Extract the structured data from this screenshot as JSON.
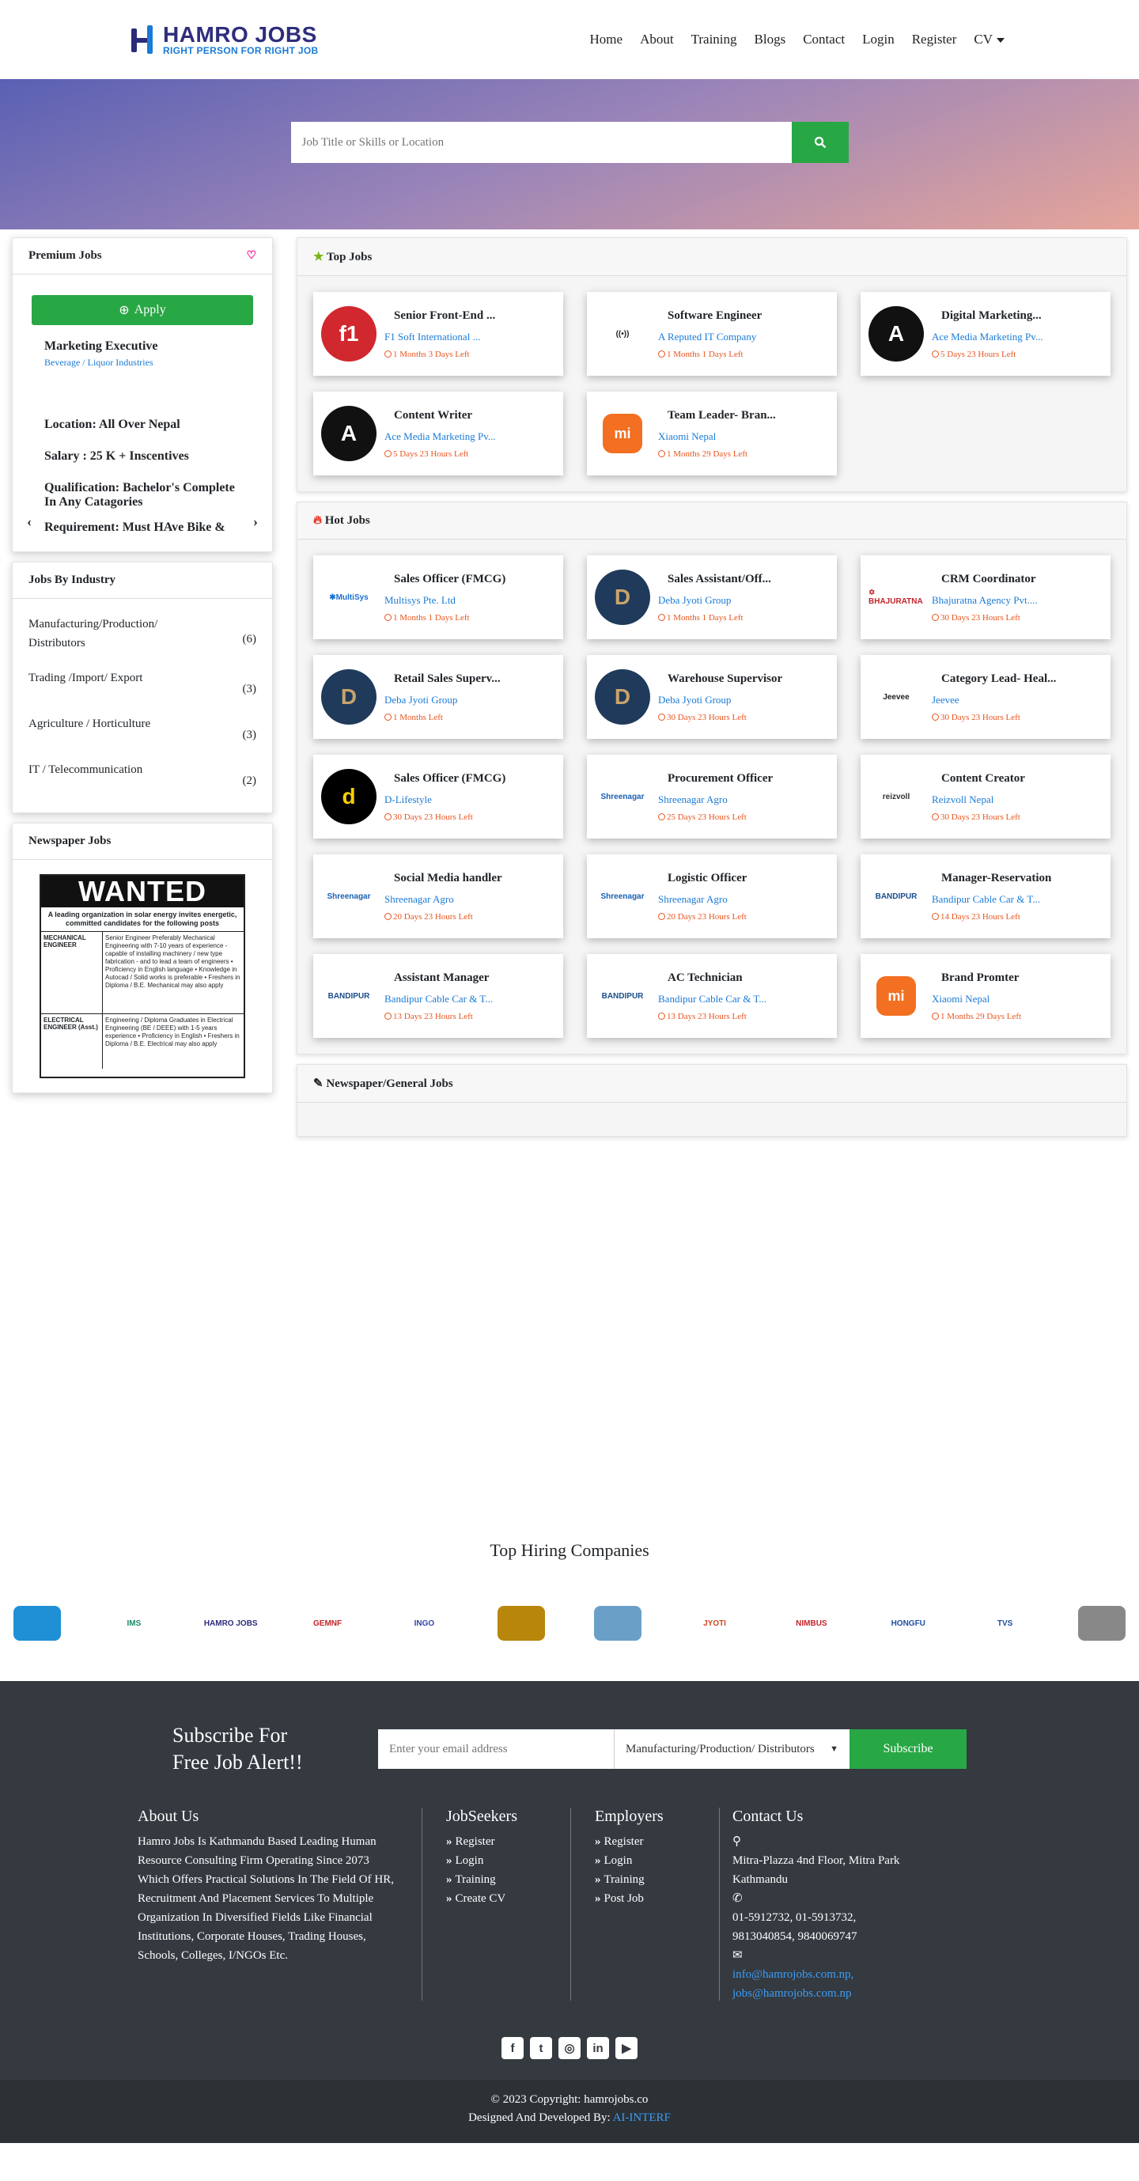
{
  "header": {
    "logo_title": "HAMRO JOBS",
    "logo_tagline": "RIGHT PERSON FOR RIGHT JOB",
    "nav": [
      "Home",
      "About",
      "Training",
      "Blogs",
      "Contact",
      "Login",
      "Register",
      "CV"
    ]
  },
  "search": {
    "placeholder": "Job Title or Skills or Location"
  },
  "premium": {
    "title": "Premium Jobs",
    "apply": "Apply",
    "job_title": "Marketing Executive",
    "company": "Beverage / Liquor Industries",
    "lines": [
      "Location: All Over Nepal",
      "Salary : 25 K + Inscentives",
      "Qualification: Bachelor's Complete In Any Catagories",
      "Requirement: Must HAve Bike &"
    ]
  },
  "industry": {
    "title": "Jobs By Industry",
    "items": [
      {
        "name": "Manufacturing/Production/ Distributors",
        "count": "(6)"
      },
      {
        "name": "Trading /Import/ Export",
        "count": "(3)"
      },
      {
        "name": "Agriculture / Horticulture",
        "count": "(3)"
      },
      {
        "name": "IT / Telecommunication",
        "count": "(2)"
      }
    ]
  },
  "newspaper": {
    "title": "Newspaper Jobs",
    "ad_heading": "WANTED",
    "ad_sub": "A leading organization in solar energy invites energetic, committed candidates for the following posts",
    "ad_rows": [
      {
        "role": "MECHANICAL ENGINEER",
        "detail": "Senior Engineer Preferably Mechanical Engineering with 7-10 years of experience - capable of installing machinery / new type fabrication - and to lead a team of engineers • Proficiency in English language • Knowledge in Autocad / Solid works is preferable • Freshers in Diploma / B.E. Mechanical may also apply"
      },
      {
        "role": "ELECTRICAL ENGINEER (Asst.)",
        "detail": "Engineering / Diploma Graduates in Electrical Engineering (BE / DEEE) with 1-5 years experience • Proficiency in English • Freshers in Diploma / B.E. Electrical may also apply"
      }
    ]
  },
  "top_jobs": {
    "title": "Top Jobs",
    "jobs": [
      {
        "title": "Senior Front-End ...",
        "company": "F1 Soft International ...",
        "deadline": "1 Months 3 Days Left",
        "logo": "f1soft"
      },
      {
        "title": "Software Engineer",
        "company": "A Reputed IT Company",
        "deadline": "1 Months 1 Days Left",
        "logo": "wifi"
      },
      {
        "title": "Digital Marketing...",
        "company": "Ace Media Marketing Pv...",
        "deadline": "5 Days 23 Hours Left",
        "logo": "ace"
      },
      {
        "title": "Content Writer",
        "company": "Ace Media Marketing Pv...",
        "deadline": "5 Days 23 Hours Left",
        "logo": "ace"
      },
      {
        "title": "Team Leader- Bran...",
        "company": "Xiaomi Nepal",
        "deadline": "1 Months 29 Days Left",
        "logo": "mi"
      }
    ]
  },
  "hot_jobs": {
    "title": "Hot Jobs",
    "jobs": [
      {
        "title": "Sales Officer (FMCG)",
        "company": "Multisys Pte. Ltd",
        "deadline": "1 Months 1 Days Left",
        "logo": "multisys"
      },
      {
        "title": "Sales Assistant/Off...",
        "company": "Deba Jyoti Group",
        "deadline": "1 Months 1 Days Left",
        "logo": "deba"
      },
      {
        "title": "CRM Coordinator",
        "company": "Bhajuratna Agency Pvt....",
        "deadline": "30 Days 23 Hours Left",
        "logo": "bhajuratna"
      },
      {
        "title": "Retail Sales Superv...",
        "company": "Deba Jyoti Group",
        "deadline": "1 Months Left",
        "logo": "deba"
      },
      {
        "title": "Warehouse Supervisor",
        "company": "Deba Jyoti Group",
        "deadline": "30 Days 23 Hours Left",
        "logo": "deba"
      },
      {
        "title": "Category Lead- Heal...",
        "company": "Jeevee",
        "deadline": "30 Days 23 Hours Left",
        "logo": "jeevee"
      },
      {
        "title": "Sales Officer (FMCG)",
        "company": "D-Lifestyle",
        "deadline": "30 Days 23 Hours Left",
        "logo": "dlife"
      },
      {
        "title": "Procurement Officer",
        "company": "Shreenagar Agro",
        "deadline": "25 Days 23 Hours Left",
        "logo": "shreenagar"
      },
      {
        "title": "Content Creator",
        "company": "Reizvoll Nepal",
        "deadline": "30 Days 23 Hours Left",
        "logo": "reizvoll"
      },
      {
        "title": "Social Media handler",
        "company": "Shreenagar Agro",
        "deadline": "20 Days 23 Hours Left",
        "logo": "shreenagar"
      },
      {
        "title": "Logistic Officer",
        "company": "Shreenagar Agro",
        "deadline": "20 Days 23 Hours Left",
        "logo": "shreenagar"
      },
      {
        "title": "Manager-Reservation",
        "company": "Bandipur Cable Car & T...",
        "deadline": "14 Days 23 Hours Left",
        "logo": "bandipur"
      },
      {
        "title": "Assistant Manager",
        "company": "Bandipur Cable Car & T...",
        "deadline": "13 Days 23 Hours Left",
        "logo": "bandipur"
      },
      {
        "title": "AC Technician",
        "company": "Bandipur Cable Car & T...",
        "deadline": "13 Days 23 Hours Left",
        "logo": "bandipur"
      },
      {
        "title": "Brand Promter",
        "company": "Xiaomi Nepal",
        "deadline": "1 Months 29 Days Left",
        "logo": "mi"
      }
    ]
  },
  "general_jobs": {
    "title": "Newspaper/General Jobs"
  },
  "companies": {
    "title": "Top Hiring Companies",
    "logos": [
      "snowflake-logo",
      "IMS",
      "HAMRO JOBS",
      "GEMNF",
      "INGO",
      "lion-logo",
      "box-logo",
      "JYOTI",
      "NIMBUS",
      "HONGFU",
      "TVS",
      "bird-logo"
    ]
  },
  "subscribe": {
    "heading": "Subscribe For Free Job Alert!!",
    "email_placeholder": "Enter your email address",
    "select_value": "Manufacturing/Production/ Distributors",
    "button": "Subscribe"
  },
  "footer": {
    "about_title": "About Us",
    "about_text": "Hamro Jobs Is Kathmandu Based Leading Human Resource Consulting Firm Operating Since 2073 Which Offers Practical Solutions In The Field Of HR, Recruitment And Placement Services To Multiple Organization In Diversified Fields Like Financial Institutions, Corporate Houses, Trading Houses, Schools, Colleges, I/NGOs Etc.",
    "seekers_title": "JobSeekers",
    "seekers_links": [
      "Register",
      "Login",
      "Training",
      "Create CV"
    ],
    "employers_title": "Employers",
    "employers_links": [
      "Register",
      "Login",
      "Training",
      "Post Job"
    ],
    "contact_title": "Contact Us",
    "address": "Mitra-Plazza 4nd Floor, Mitra Park Kathmandu",
    "phones": "01-5912732, 01-5913732, 9813040854, 9840069747",
    "email1": "info@hamrojobs.com.np,",
    "email2": "jobs@hamrojobs.com.np",
    "social": [
      "facebook-icon",
      "twitter-icon",
      "instagram-icon",
      "linkedin-icon",
      "youtube-icon"
    ],
    "copyright": "© 2023 Copyright: hamrojobs.co",
    "designed_prefix": "Designed And Developed By:",
    "designed_by": "AI-INTERF"
  }
}
